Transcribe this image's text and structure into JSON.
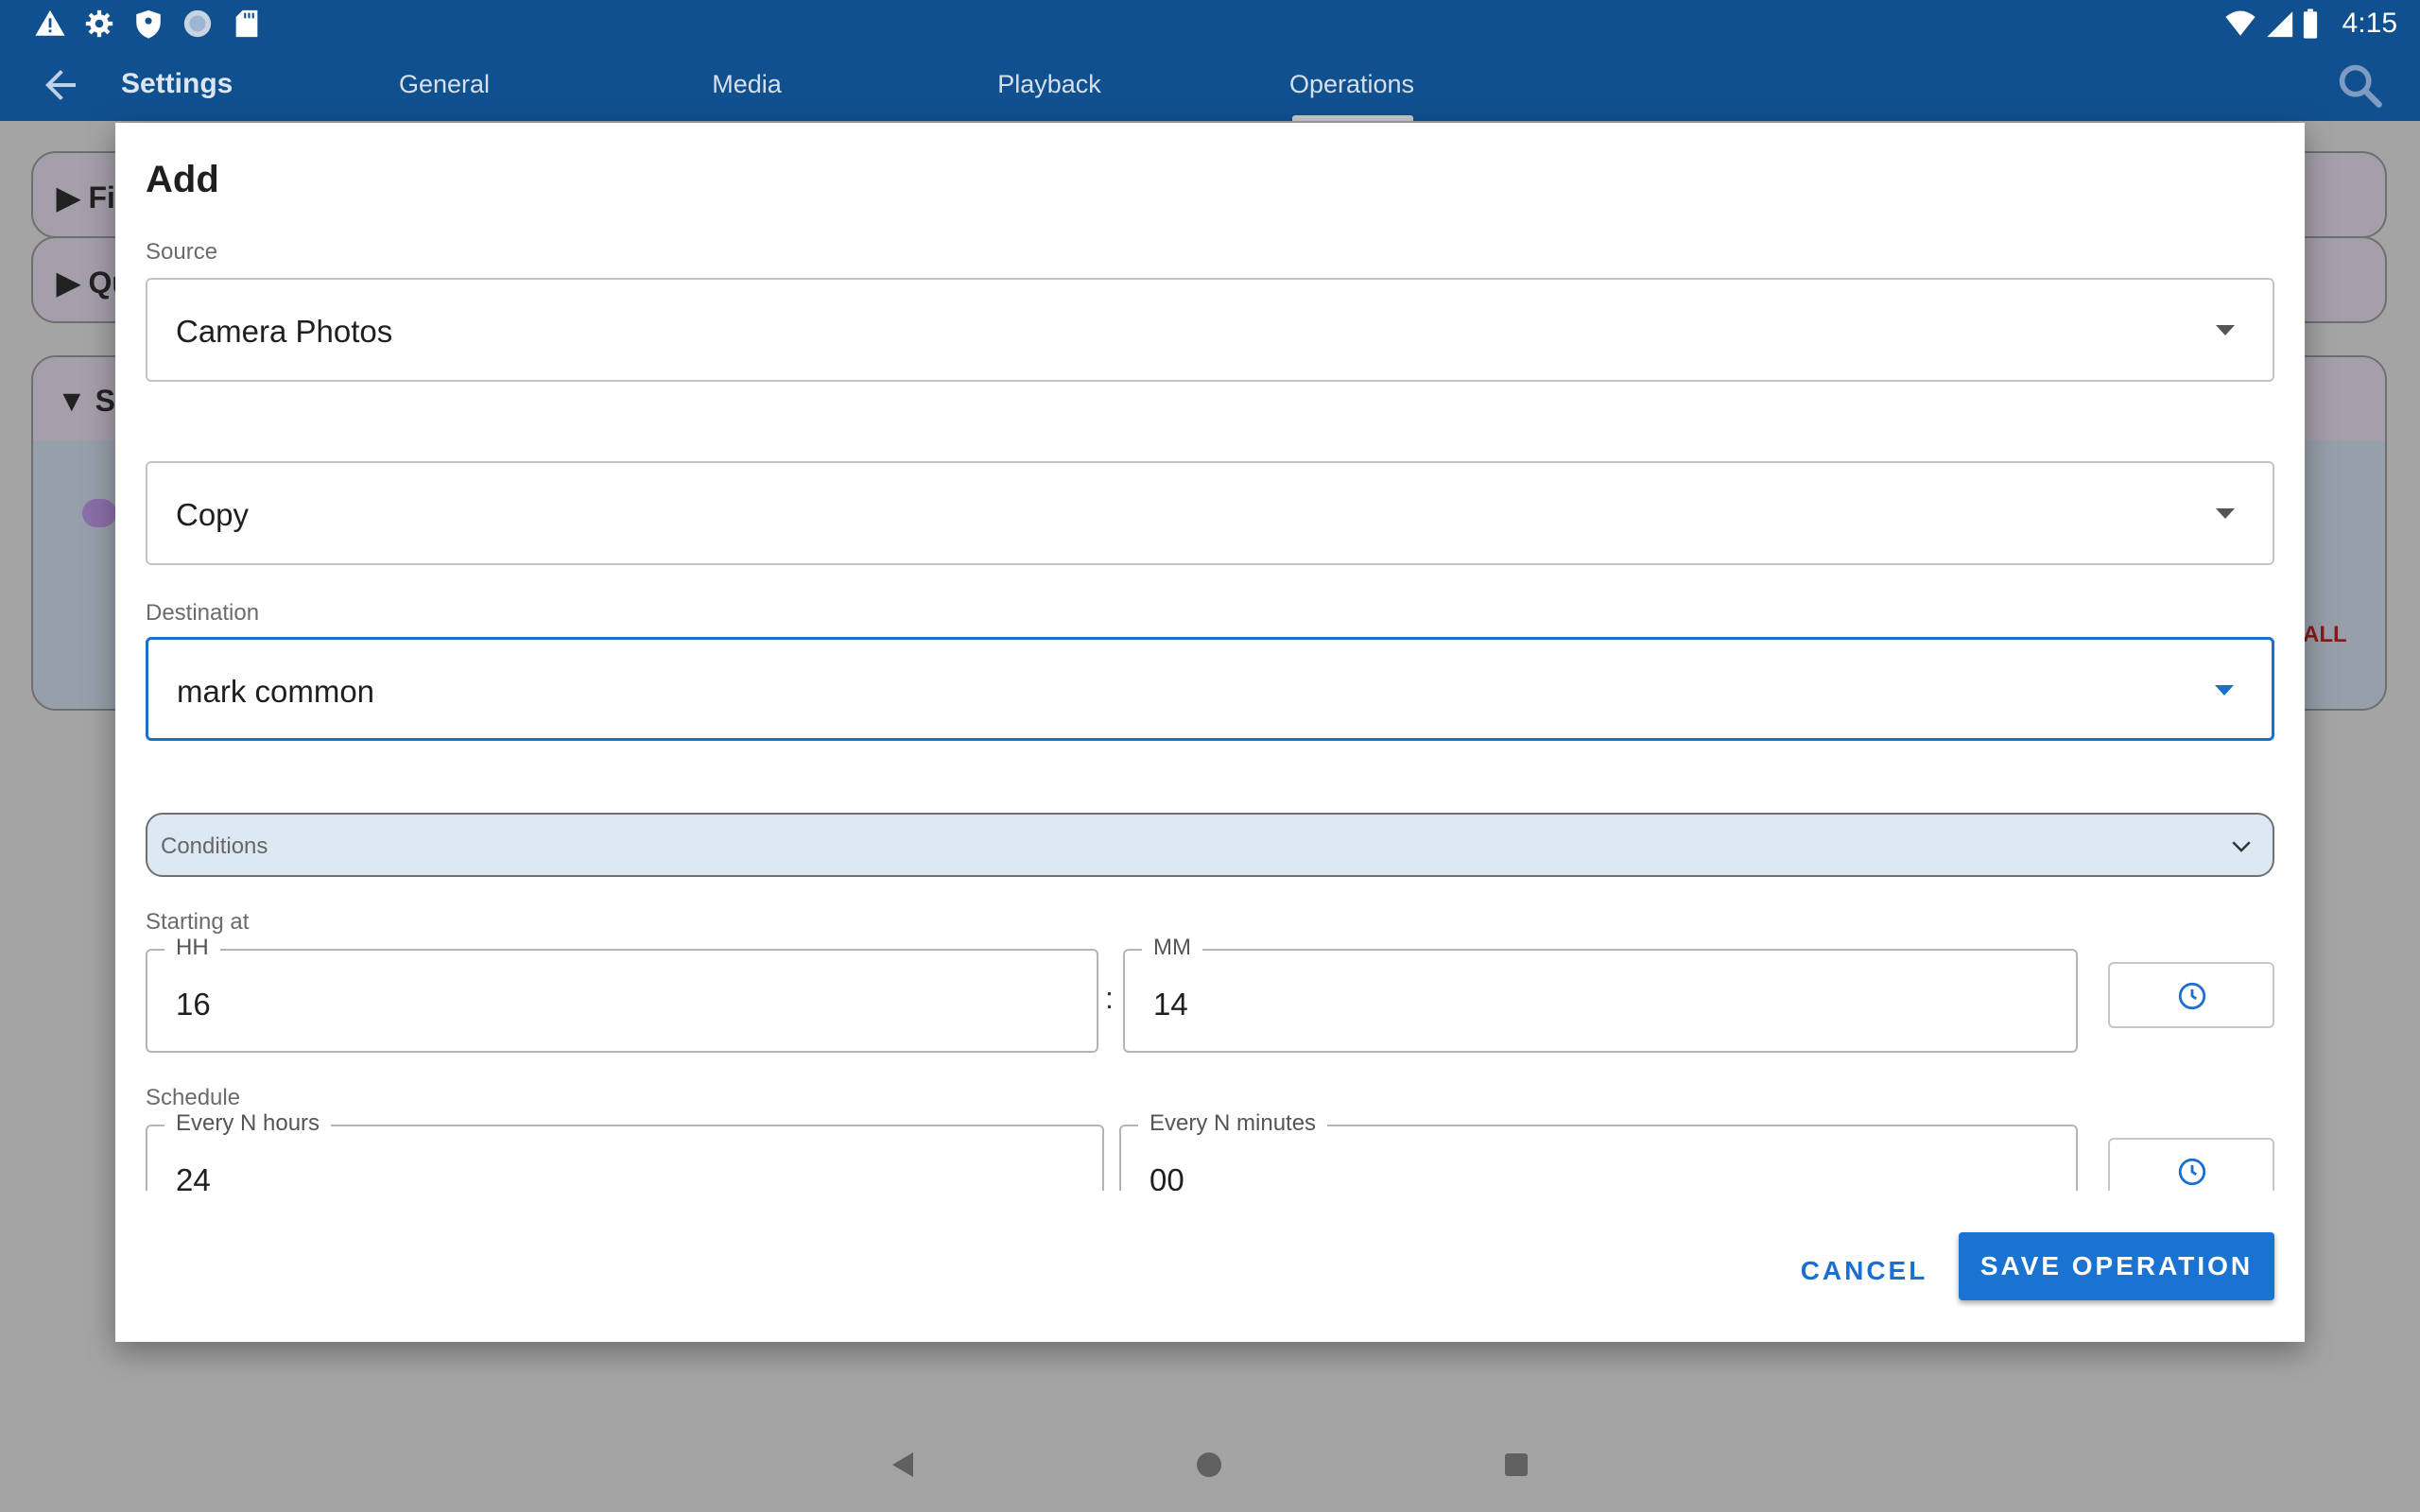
{
  "status_bar": {
    "time": "4:15",
    "left_icons": [
      "warning-icon",
      "gear-icon",
      "shield-icon",
      "globe-icon",
      "sd-card-icon"
    ],
    "right_icons": [
      "wifi-icon",
      "signal-icon",
      "battery-icon"
    ]
  },
  "toolbar": {
    "title": "Settings",
    "tabs": [
      {
        "label": "General"
      },
      {
        "label": "Media"
      },
      {
        "label": "Playback"
      },
      {
        "label": "Operations",
        "selected": true
      }
    ]
  },
  "background": {
    "card1_text": "▶ Fi",
    "card2_text": "▶ Qu",
    "card3_text": "▼ Sc",
    "red_text": "ALL"
  },
  "dialog": {
    "title": "Add",
    "source": {
      "label": "Source",
      "value": "Camera Photos"
    },
    "operation": {
      "value": "Copy"
    },
    "destination": {
      "label": "Destination",
      "value": "mark common"
    },
    "conditions": {
      "label": "Conditions"
    },
    "starting_at": {
      "label": "Starting at",
      "hh": {
        "legend": "HH",
        "value": "16"
      },
      "separator": ":",
      "mm": {
        "legend": "MM",
        "value": "14"
      }
    },
    "schedule": {
      "label": "Schedule",
      "hours": {
        "legend": "Every N hours",
        "value": "24"
      },
      "minutes": {
        "legend": "Every N minutes",
        "value": "00"
      }
    },
    "cancel_label": "CANCEL",
    "save_label": "SAVE OPERATION"
  },
  "colors": {
    "app_bar": "#11508f",
    "accent": "#1a73d1",
    "conditions_bg": "#dde8f5"
  }
}
